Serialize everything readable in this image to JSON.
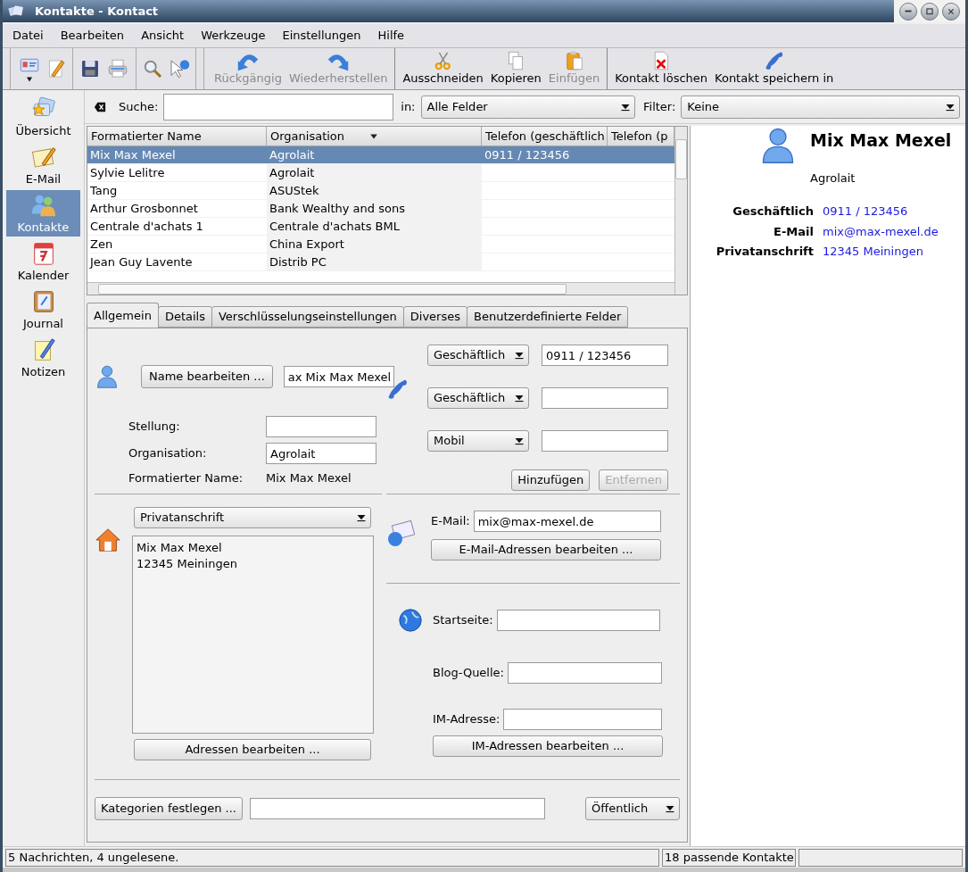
{
  "window": {
    "title": "Kontakte - Kontact"
  },
  "menu": [
    "Datei",
    "Bearbeiten",
    "Ansicht",
    "Werkzeuge",
    "Einstellungen",
    "Hilfe"
  ],
  "toolbar": [
    {
      "label": "Rückgängig",
      "disabled": true
    },
    {
      "label": "Wiederherstellen",
      "disabled": true
    },
    {
      "label": "Ausschneiden",
      "disabled": false
    },
    {
      "label": "Kopieren",
      "disabled": false
    },
    {
      "label": "Einfügen",
      "disabled": true
    },
    {
      "label": "Kontakt löschen",
      "disabled": false
    },
    {
      "label": "Kontakt speichern in",
      "disabled": false
    }
  ],
  "sidebar": {
    "items": [
      {
        "label": "Übersicht",
        "selected": false
      },
      {
        "label": "E-Mail",
        "selected": false
      },
      {
        "label": "Kontakte",
        "selected": true
      },
      {
        "label": "Kalender",
        "selected": false
      },
      {
        "label": "Journal",
        "selected": false
      },
      {
        "label": "Notizen",
        "selected": false
      }
    ]
  },
  "search": {
    "label": "Suche:",
    "scope_label": "in:",
    "scope_value": "Alle Felder",
    "filter_label": "Filter:",
    "filter_value": "Keine"
  },
  "table": {
    "columns": [
      "Formatierter Name",
      "Organisation",
      "Telefon (geschäftlich",
      "Telefon (p"
    ],
    "rows": [
      {
        "cells": [
          "Mix Max Mexel",
          "Agrolait",
          "0911 / 123456"
        ],
        "selected": true
      },
      {
        "cells": [
          "Sylvie Lelitre",
          "Agrolait"
        ],
        "selected": false
      },
      {
        "cells": [
          "Tang",
          "ASUStek"
        ],
        "selected": false
      },
      {
        "cells": [
          "Arthur Grosbonnet",
          "Bank Wealthy and sons"
        ],
        "selected": false
      },
      {
        "cells": [
          "Centrale d'achats 1",
          "Centrale d'achats BML"
        ],
        "selected": false
      },
      {
        "cells": [
          "Zen",
          "China Export"
        ],
        "selected": false
      },
      {
        "cells": [
          "Jean Guy Lavente",
          "Distrib PC"
        ],
        "selected": false
      }
    ]
  },
  "tabs": [
    {
      "label": "Allgemein",
      "selected": true
    },
    {
      "label": "Details",
      "selected": false
    },
    {
      "label": "Verschlüsselungseinstellungen",
      "selected": false
    },
    {
      "label": "Diverses",
      "selected": false
    },
    {
      "label": "Benutzerdefinierte Felder",
      "selected": false
    }
  ],
  "general": {
    "name_button": "Name bearbeiten ...",
    "name_value": "ax Mix Max Mexel",
    "fields": [
      {
        "label": "Stellung:"
      },
      {
        "label": "Organisation:",
        "value": "Agrolait"
      }
    ],
    "formatted_name_label": "Formatierter Name:",
    "formatted_name_value": "Mix Max Mexel",
    "phones": [
      {
        "type": "Geschäftlich",
        "number": "0911 / 123456"
      },
      {
        "type": "Geschäftlich"
      },
      {
        "type": "Mobil"
      }
    ],
    "add_button": {
      "label": "Hinzufügen",
      "disabled": false
    },
    "remove_button": {
      "label": "Entfernen",
      "disabled": true
    },
    "address": {
      "type": "Privatanschrift",
      "lines": [
        "Mix Max Mexel",
        "12345 Meiningen"
      ],
      "edit_button": "Adressen bearbeiten ..."
    },
    "email": {
      "label": "E-Mail:",
      "value": "mix@max-mexel.de",
      "edit_button": "E-Mail-Adressen bearbeiten ..."
    },
    "homepage_label": "Startseite:",
    "blog_label": "Blog-Quelle:",
    "im_label": "IM-Adresse:",
    "im_button": "IM-Adressen bearbeiten ...",
    "categories_button": "Kategorien festlegen ...",
    "access": "Öffentlich"
  },
  "detail": {
    "name": "Mix Max Mexel",
    "organisation": "Agrolait",
    "rows": [
      {
        "label": "Geschäftlich",
        "value": "0911 / 123456"
      },
      {
        "label": "E-Mail",
        "value": "mix@max-mexel.de"
      },
      {
        "label": "Privatanschrift",
        "value": "12345 Meiningen"
      }
    ]
  },
  "status_bar": [
    "5 Nachrichten, 4 ungelesene.",
    "18 passende Kontakte"
  ]
}
